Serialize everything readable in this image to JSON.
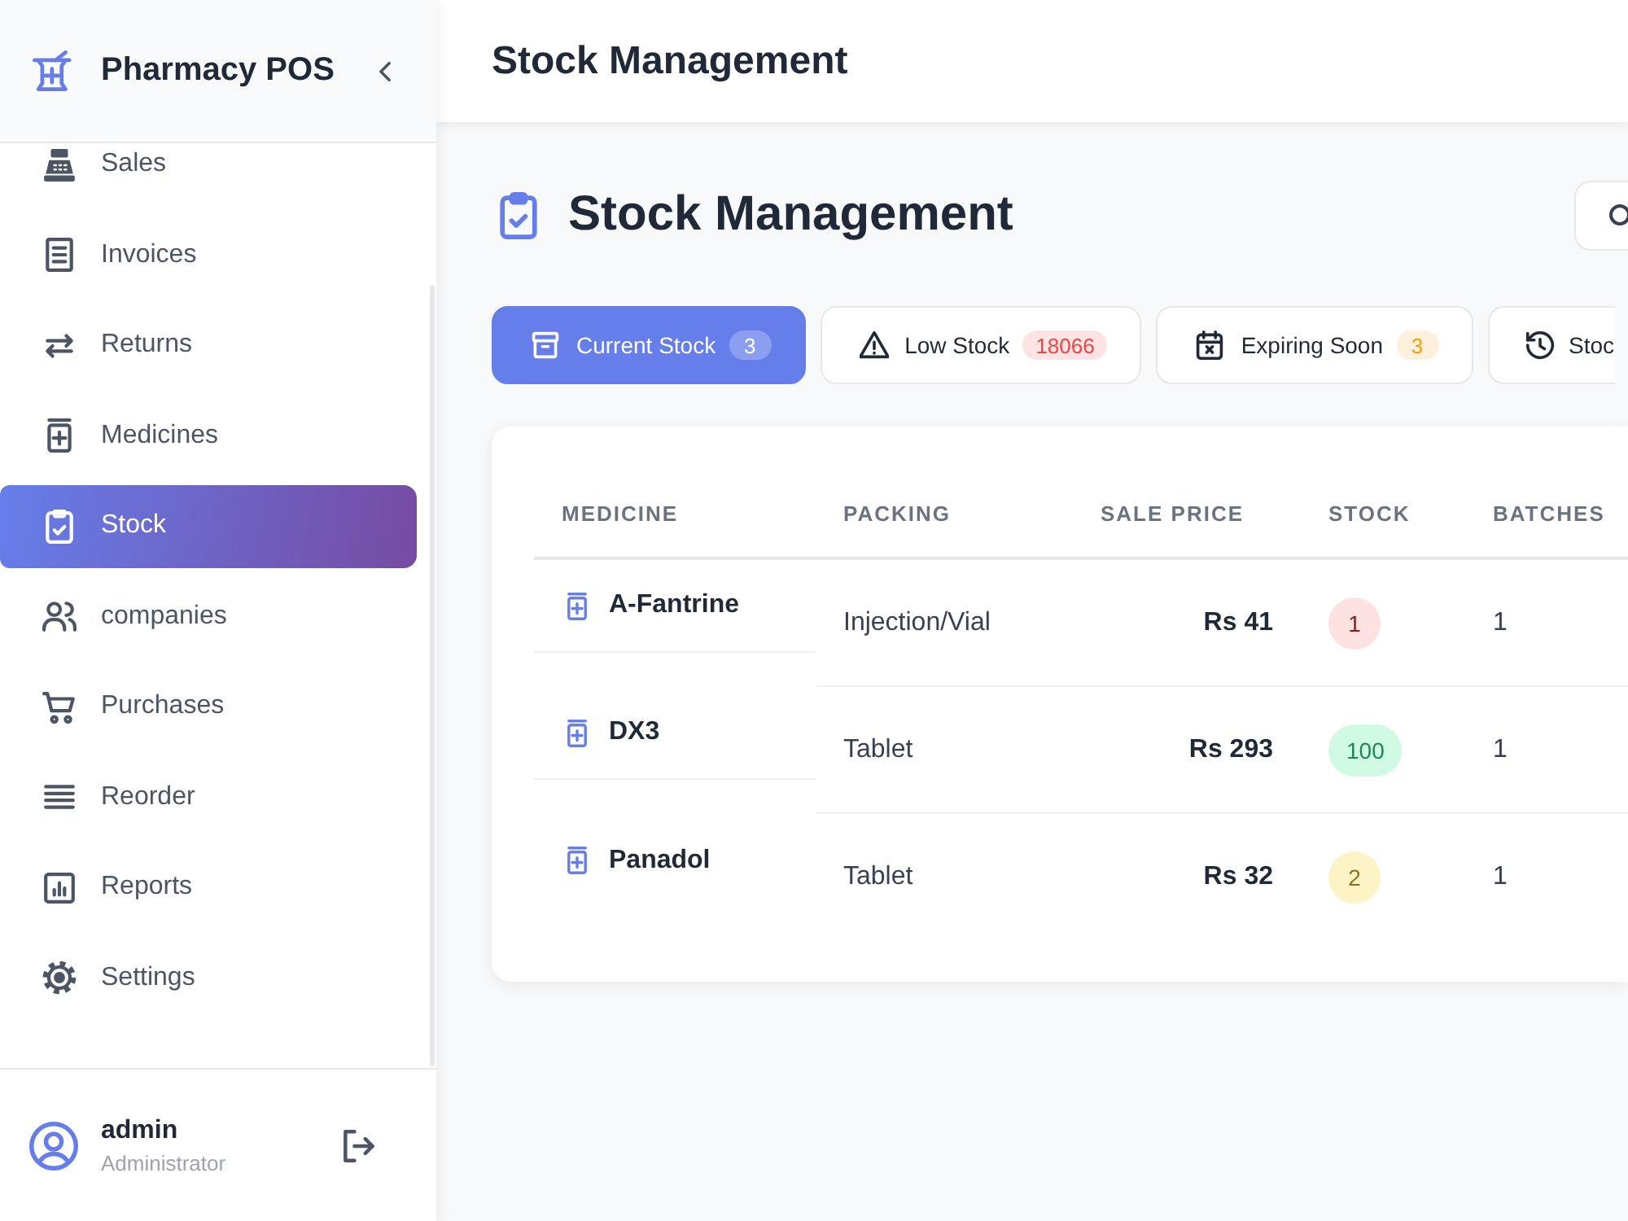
{
  "sidebar": {
    "brand": "Pharmacy POS",
    "nav_items": [
      {
        "label": "Sales",
        "selected": false
      },
      {
        "label": "Invoices",
        "selected": false
      },
      {
        "label": "Returns",
        "selected": false
      },
      {
        "label": "Medicines",
        "selected": false
      },
      {
        "label": "Stock",
        "selected": true
      },
      {
        "label": "companies",
        "selected": false
      },
      {
        "label": "Purchases",
        "selected": false
      },
      {
        "label": "Reorder",
        "selected": false
      },
      {
        "label": "Reports",
        "selected": false
      },
      {
        "label": "Settings",
        "selected": false
      }
    ],
    "user": {
      "name": "admin",
      "role": "Administrator"
    }
  },
  "top_bar": {
    "title": "Stock Management"
  },
  "page": {
    "heading": "Stock Management"
  },
  "tabs": [
    {
      "label": "Current Stock",
      "count": "3",
      "selected": true
    },
    {
      "label": "Low Stock",
      "count": "18066",
      "color": "#ef4444",
      "selected": false
    },
    {
      "label": "Expiring Soon",
      "count": "3",
      "color": "#f59e0b",
      "selected": false
    },
    {
      "label": "Stoc",
      "selected": false
    }
  ],
  "table": {
    "columns": [
      "MEDICINE",
      "PACKING",
      "SALE PRICE",
      "STOCK",
      "BATCHES"
    ],
    "rows": [
      {
        "medicine": "A-Fantrine",
        "packing": "Injection/Vial",
        "sale_price": "Rs 41",
        "stock": "1",
        "color": "#fee2e2",
        "batches": "1"
      },
      {
        "medicine": "DX3",
        "packing": "Tablet",
        "sale_price": "Rs 293",
        "stock": "100",
        "color": "#d1fae5",
        "batches": "1"
      },
      {
        "medicine": "Panadol",
        "packing": "Tablet",
        "sale_price": "Rs 32",
        "stock": "2",
        "color": "#fef3c7",
        "batches": "1"
      }
    ]
  }
}
